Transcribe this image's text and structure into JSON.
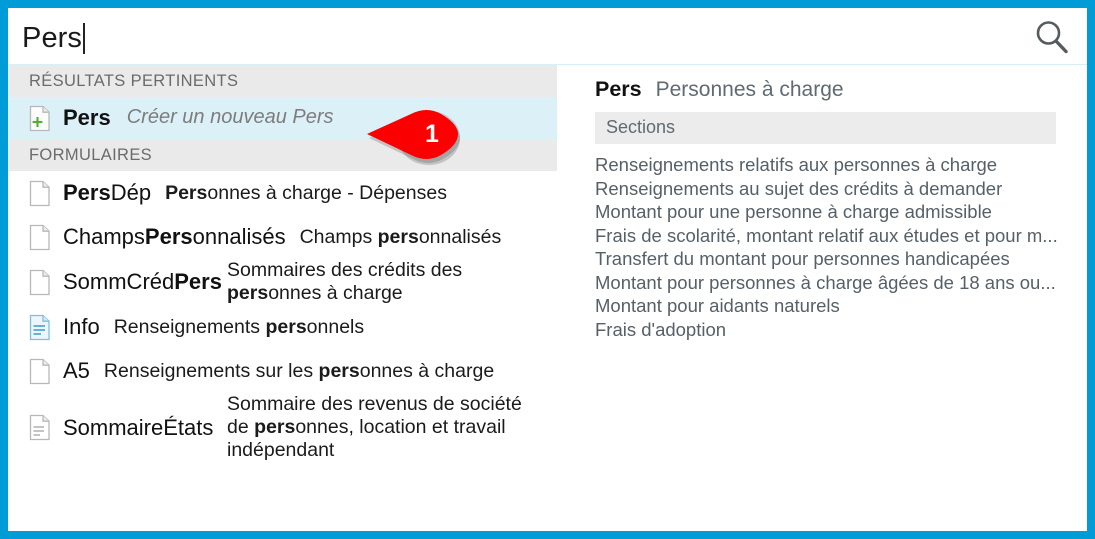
{
  "window": {
    "border_color": "#009cd8",
    "background": "#ffffff"
  },
  "search": {
    "value": "Pers",
    "placeholder": "",
    "icon": "search-icon"
  },
  "left_panel": {
    "groups": [
      {
        "header": "RÉSULTATS PERTINENTS",
        "items": [
          {
            "icon": "document-add-icon",
            "code_bold": "Pers",
            "code_rest": "",
            "description_plain": "Créer un nouveau Pers",
            "italic": true,
            "selected": true
          }
        ]
      },
      {
        "header": "FORMULAIRES",
        "items": [
          {
            "icon": "document-icon",
            "code_bold": "Pers",
            "code_rest": "Dép",
            "desc_pre": "",
            "desc_bold": "Pers",
            "desc_post": "onnes à charge - Dépenses",
            "selected": false
          },
          {
            "icon": "document-icon",
            "code_pre": "Champs",
            "code_bold": "Pers",
            "code_rest": "onnalisés",
            "desc_pre": "Champs ",
            "desc_bold": "pers",
            "desc_post": "onnalisés",
            "selected": false
          },
          {
            "icon": "document-icon",
            "code_pre": "SommCréd",
            "code_bold": "Pers",
            "code_rest": "",
            "desc_pre": "Sommaires des crédits des ",
            "desc_bold": "pers",
            "desc_post": "onnes à charge",
            "wrapped": true,
            "selected": false
          },
          {
            "icon": "document-lines-blue-icon",
            "code_pre": "Info",
            "code_bold": "",
            "code_rest": "",
            "desc_pre": "Renseignements ",
            "desc_bold": "pers",
            "desc_post": "onnels",
            "selected": false
          },
          {
            "icon": "document-icon",
            "code_pre": "A5",
            "code_bold": "",
            "code_rest": "",
            "desc_pre": "Renseignements sur les ",
            "desc_bold": "pers",
            "desc_post": "onnes à charge",
            "selected": false
          },
          {
            "icon": "document-lines-icon",
            "code_pre": "SommaireÉtats",
            "code_bold": "",
            "code_rest": "",
            "desc_pre": "Sommaire des revenus de société de ",
            "desc_bold": "pers",
            "desc_post": "onnes, location et travail indépendant",
            "wrapped": true,
            "selected": false
          }
        ]
      }
    ]
  },
  "right_panel": {
    "title_code": "Pers",
    "title_description": "Personnes à charge",
    "sections_header": "Sections",
    "sections": [
      "Renseignements relatifs aux personnes à charge",
      "Renseignements au sujet des crédits à demander",
      "Montant pour une personne à charge admissible",
      "Frais de scolarité, montant relatif aux études et pour m...",
      "Transfert du montant pour personnes handicapées",
      "Montant pour personnes à charge âgées de 18 ans ou...",
      "Montant pour aidants naturels",
      "Frais d'adoption"
    ]
  },
  "callout": {
    "label": "1",
    "color": "#fb0000",
    "text_color": "#ffffff"
  }
}
